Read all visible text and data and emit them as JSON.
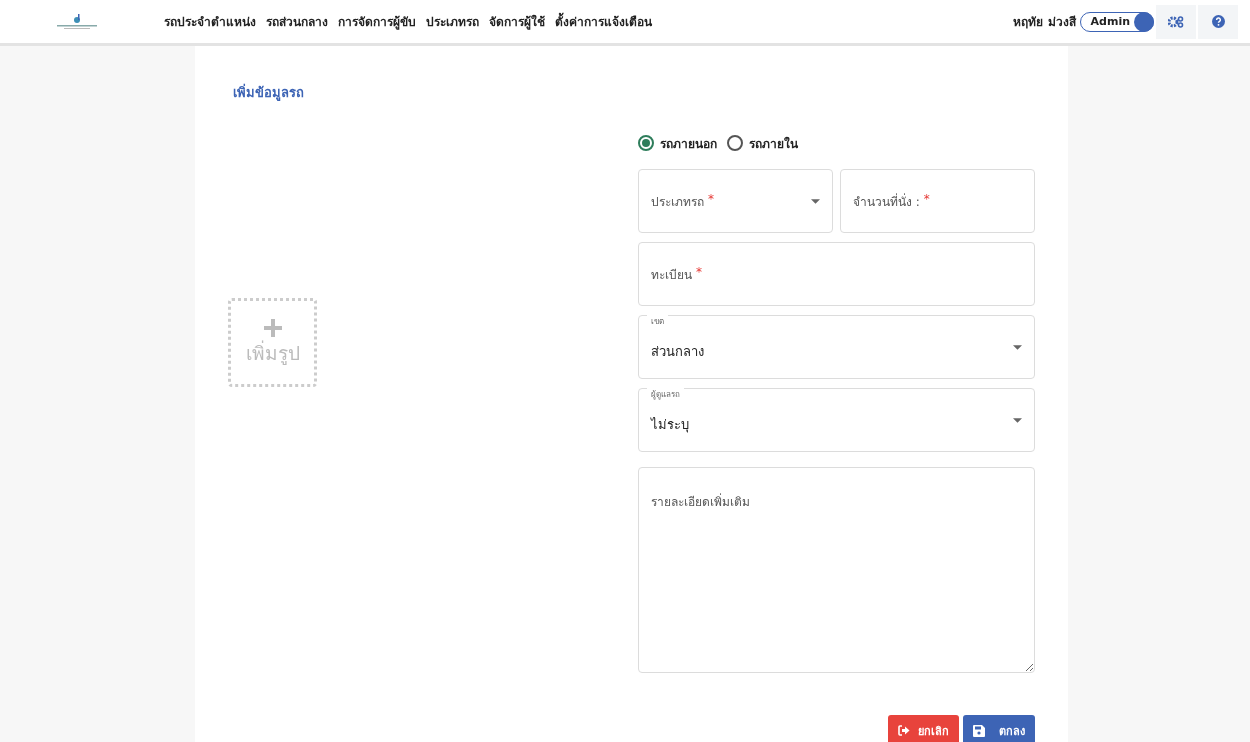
{
  "navbar": {
    "menu": [
      {
        "label": "รถประจำตำแหน่ง"
      },
      {
        "label": "รถส่วนกลาง"
      },
      {
        "label": "การจัดการผู้ขับ"
      },
      {
        "label": "ประเภทรถ"
      },
      {
        "label": "จัดการผู้ใช้"
      },
      {
        "label": "ตั้งค่าการแจ้งเตือน"
      }
    ],
    "user": "หฤทัย ม่วงสี",
    "role_switch": {
      "label": "Admin",
      "on": true
    }
  },
  "page_title": "เพิ่มข้อมูลรถ",
  "upload": {
    "label": "เพิ่มรูป"
  },
  "car_source": [
    {
      "label": "รถภายนอก",
      "selected": true
    },
    {
      "label": "รถภายใน",
      "selected": false
    }
  ],
  "fields": [
    {
      "kind": "select",
      "label": "ประเภทรถ",
      "required_mark": "*"
    },
    {
      "kind": "input",
      "label": "จำนวนที่นั่ง :",
      "required_mark": "*"
    },
    {
      "kind": "input",
      "label": "ทะเบียน",
      "required_mark": "*"
    },
    {
      "kind": "select",
      "label": "เขต",
      "value": "ส่วนกลาง"
    },
    {
      "kind": "select",
      "label": "ผู้ดูแลรถ",
      "value": "ไม่ระบุ"
    }
  ],
  "notes": {
    "placeholder": "รายละเอียดเพิ่มเติม"
  },
  "buttons": [
    {
      "kind": "cancel",
      "label": "ยกเลิก"
    },
    {
      "kind": "save",
      "label": "ตกลง"
    }
  ]
}
